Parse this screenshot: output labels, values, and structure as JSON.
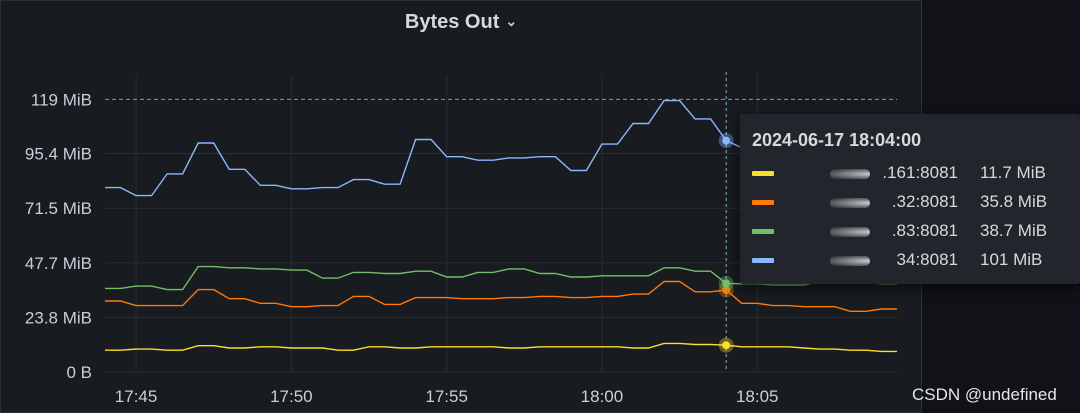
{
  "panel": {
    "title": "Bytes Out",
    "chevron": "⌄"
  },
  "chart_data": {
    "type": "line",
    "title": "Bytes Out",
    "y_unit": "MiB",
    "ylim": [
      0,
      119.2
    ],
    "threshold": 119,
    "y_ticks": [
      {
        "value": 0,
        "label": "0 B"
      },
      {
        "value": 23.8,
        "label": "23.8 MiB"
      },
      {
        "value": 47.7,
        "label": "47.7 MiB"
      },
      {
        "value": 71.5,
        "label": "71.5 MiB"
      },
      {
        "value": 95.4,
        "label": "95.4 MiB"
      },
      {
        "value": 119,
        "label": "119 MiB"
      }
    ],
    "x_ticks": [
      {
        "time": "17:45",
        "label": "17:45"
      },
      {
        "time": "17:50",
        "label": "17:50"
      },
      {
        "time": "17:55",
        "label": "17:55"
      },
      {
        "time": "18:00",
        "label": "18:00"
      },
      {
        "time": "18:05",
        "label": "18:05"
      }
    ],
    "x_range": [
      "17:44:00",
      "18:09:30"
    ],
    "x": [
      "17:44:00",
      "17:44:30",
      "17:45:00",
      "17:45:30",
      "17:46:00",
      "17:46:30",
      "17:47:00",
      "17:47:30",
      "17:48:00",
      "17:48:30",
      "17:49:00",
      "17:49:30",
      "17:50:00",
      "17:50:30",
      "17:51:00",
      "17:51:30",
      "17:52:00",
      "17:52:30",
      "17:53:00",
      "17:53:30",
      "17:54:00",
      "17:54:30",
      "17:55:00",
      "17:55:30",
      "17:56:00",
      "17:56:30",
      "17:57:00",
      "17:57:30",
      "17:58:00",
      "17:58:30",
      "17:59:00",
      "17:59:30",
      "18:00:00",
      "18:00:30",
      "18:01:00",
      "18:01:30",
      "18:02:00",
      "18:02:30",
      "18:03:00",
      "18:03:30",
      "18:04:00",
      "18:04:30",
      "18:05:00",
      "18:05:30",
      "18:06:00",
      "18:06:30",
      "18:07:00",
      "18:07:30",
      "18:08:00",
      "18:08:30",
      "18:09:00",
      "18:09:30"
    ],
    "cursor_time": "18:04:00",
    "series": [
      {
        "name": ".161:8081",
        "color": "#fade2a",
        "values": [
          9.5,
          9.5,
          10,
          10,
          9.5,
          9.5,
          11.5,
          11.5,
          10.5,
          10.5,
          11,
          11,
          10.5,
          10.5,
          10.5,
          9.5,
          9.5,
          11,
          11,
          10.5,
          10.5,
          11,
          11,
          11,
          11,
          11,
          10.5,
          10.5,
          11,
          11,
          11,
          11,
          11,
          11,
          10.5,
          10.5,
          12.5,
          12.5,
          12,
          12,
          11.7,
          11,
          11,
          11,
          11,
          10.5,
          10,
          10,
          9.5,
          9.5,
          9,
          9
        ]
      },
      {
        "name": ".32:8081",
        "color": "#ff780a",
        "values": [
          31,
          31,
          29,
          29,
          29,
          29,
          36,
          36,
          32,
          32,
          30,
          30,
          28.5,
          28.5,
          29,
          29,
          33,
          33,
          29.5,
          29.5,
          32.5,
          32.5,
          32.5,
          32,
          32,
          32,
          32.5,
          32.5,
          33,
          33,
          32.5,
          32.5,
          33,
          33,
          34,
          34,
          39.5,
          39.5,
          35,
          35,
          35.8,
          30,
          30,
          29,
          29,
          28.5,
          28.5,
          28.5,
          26.5,
          26.5,
          27.5,
          27.5
        ]
      },
      {
        "name": ".83:8081",
        "color": "#73bf69",
        "values": [
          36.5,
          36.5,
          37.5,
          37.5,
          36,
          36,
          46,
          46,
          45.5,
          45.5,
          45,
          45,
          44.5,
          44.5,
          41,
          41,
          43.5,
          43.5,
          43,
          43,
          44,
          44,
          41.5,
          41.5,
          43.5,
          43.5,
          45,
          45,
          43,
          43,
          41.5,
          41.5,
          42,
          42,
          42,
          42,
          45.5,
          45.5,
          44,
          44,
          38.7,
          38.5,
          38.5,
          38,
          38,
          38,
          39.5,
          39.5,
          39,
          39,
          38.5,
          38.5
        ]
      },
      {
        "name": "34:8081",
        "color": "#8ab8ff",
        "values": [
          80.5,
          80.5,
          77,
          77,
          86.5,
          86.5,
          100,
          100,
          88.5,
          88.5,
          81.5,
          81.5,
          80,
          80,
          80.5,
          80.5,
          84,
          84,
          82,
          82,
          101.5,
          101.5,
          94,
          94,
          92.5,
          92.5,
          93.5,
          93.5,
          94,
          94,
          88,
          88,
          99.5,
          99.5,
          108.5,
          108.5,
          118.5,
          118.5,
          110.5,
          110.5,
          101,
          98,
          98,
          98,
          98,
          98,
          98,
          98,
          98,
          98,
          98,
          98
        ]
      }
    ]
  },
  "tooltip": {
    "time": "2024-06-17 18:04:00",
    "rows": [
      {
        "label": ".161:8081",
        "value": "11.7 MiB",
        "color": "#fade2a"
      },
      {
        "label": ".32:8081",
        "value": "35.8 MiB",
        "color": "#ff780a"
      },
      {
        "label": ".83:8081",
        "value": "38.7 MiB",
        "color": "#73bf69"
      },
      {
        "label": "34:8081",
        "value": "101 MiB",
        "color": "#8ab8ff"
      }
    ]
  },
  "watermark": "CSDN @undefined"
}
